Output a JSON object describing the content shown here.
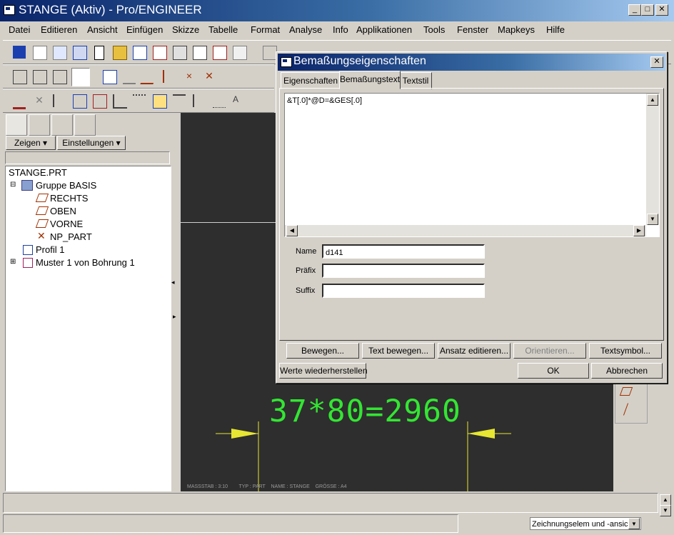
{
  "window": {
    "title": "STANGE (Aktiv) - Pro/ENGINEER"
  },
  "menu": [
    "Datei",
    "Editieren",
    "Ansicht",
    "Einfügen",
    "Skizze",
    "Tabelle",
    "Format",
    "Analyse",
    "Info",
    "Applikationen",
    "Tools",
    "Fenster",
    "Mapkeys",
    "Hilfe"
  ],
  "nav": {
    "zeigen": "Zeigen",
    "einstellungen": "Einstellungen"
  },
  "tree": {
    "root": "STANGE.PRT",
    "items": [
      "Gruppe BASIS",
      "RECHTS",
      "OBEN",
      "VORNE",
      "NP_PART",
      "Profil 1",
      "Muster 1 von Bohrung 1"
    ]
  },
  "drawing": {
    "dimension_text": "37*80=2960",
    "title_block": "MASSSTAB : 3:10        TYP : PART    NAME : STANGE    GRÖSSE : A4"
  },
  "dialog": {
    "title": "Bemaßungseigenschaften",
    "tabs": [
      "Eigenschaften",
      "Bemaßungstext",
      "Textstil"
    ],
    "text_value": "&T[.0]*@D=&GES[.0]",
    "name_label": "Name",
    "name_value": "d141",
    "prefix_label": "Präfix",
    "prefix_value": "",
    "suffix_label": "Suffix",
    "suffix_value": "",
    "buttons": [
      "Bewegen...",
      "Text bewegen...",
      "Ansatz editieren...",
      "Orientieren...",
      "Textsymbol..."
    ],
    "restore": "Werte wiederherstellen",
    "ok": "OK",
    "cancel": "Abbrechen"
  },
  "status": {
    "filter": "Zeichnungselem und -ansic"
  },
  "colors": {
    "dimension": "#33e633",
    "leader": "#e6e633",
    "canvas": "#2e2e2e"
  }
}
